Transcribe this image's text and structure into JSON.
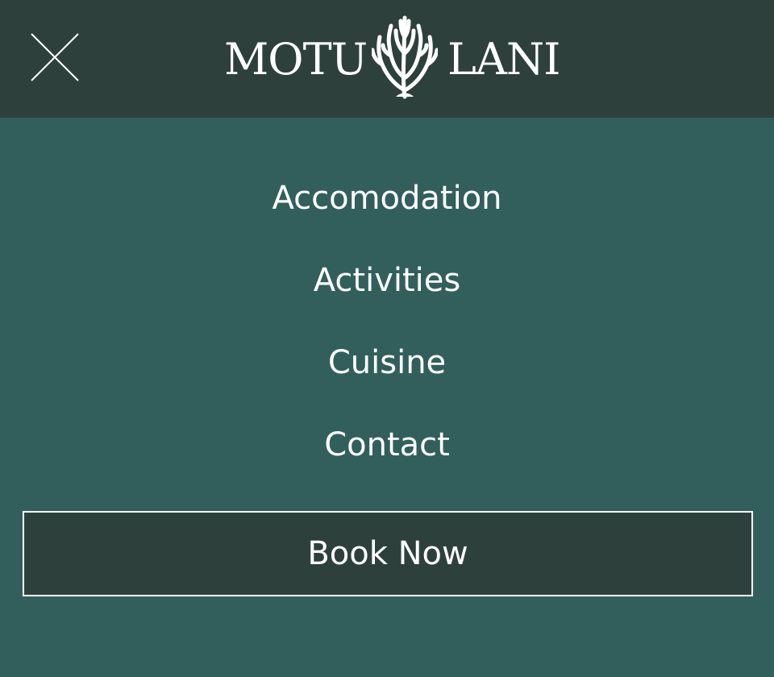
{
  "header": {
    "close_icon": "close-icon",
    "logo": {
      "left_word": "MOTU",
      "right_word": "LANI",
      "emblem_icon": "coral-icon"
    }
  },
  "nav": {
    "items": [
      {
        "label": "Accomodation"
      },
      {
        "label": "Activities"
      },
      {
        "label": "Cuisine"
      },
      {
        "label": "Contact"
      }
    ]
  },
  "cta": {
    "label": "Book Now"
  },
  "colors": {
    "header_bg": "#2e403b",
    "menu_bg": "#325f5c",
    "text": "#ffffff",
    "button_bg": "#2e403b"
  }
}
